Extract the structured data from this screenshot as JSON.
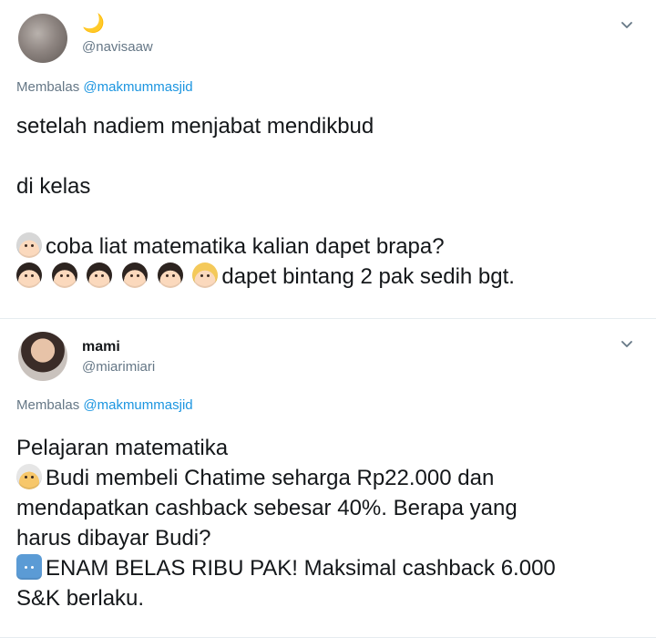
{
  "tweet1": {
    "display_name": "🌙",
    "handle": "@navisaaw",
    "reply_prefix": "Membalas",
    "reply_to": "@makmummasjid",
    "line1": "setelah nadiem menjabat mendikbud",
    "line2": "di kelas",
    "line3": "coba liat matematika kalian dapet brapa?",
    "line4": "dapet bintang 2 pak sedih bgt."
  },
  "tweet2": {
    "display_name": "mami",
    "handle": "@miarimiari",
    "reply_prefix": "Membalas",
    "reply_to": "@makmummasjid",
    "line1": "Pelajaran matematika",
    "line2": "Budi membeli Chatime seharga Rp22.000 dan",
    "line3": "mendapatkan cashback sebesar 40%. Berapa yang",
    "line4": "harus dibayar Budi?",
    "line5": "ENAM BELAS RIBU PAK! Maksimal cashback 6.000",
    "line6": "S&K berlaku."
  }
}
